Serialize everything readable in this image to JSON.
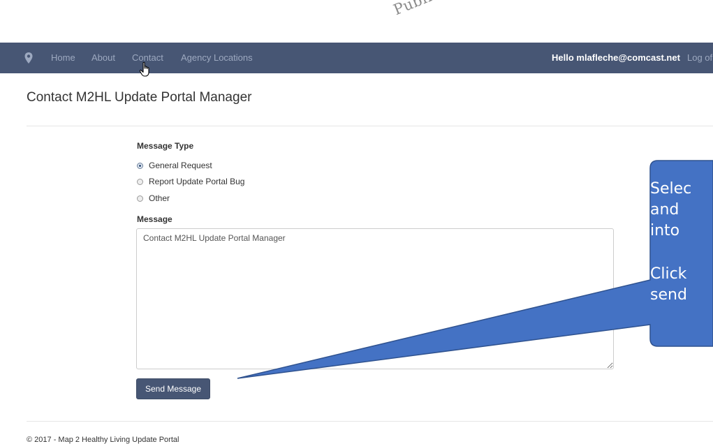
{
  "watermark": "Public",
  "nav": {
    "links": [
      "Home",
      "About",
      "Contact",
      "Agency Locations"
    ],
    "greeting": "Hello mlafleche@comcast.net",
    "logoff": "Log of"
  },
  "page": {
    "title": "Contact M2HL Update Portal Manager"
  },
  "form": {
    "message_type_label": "Message Type",
    "options": [
      "General Request",
      "Report Update Portal Bug",
      "Other"
    ],
    "selected_option": "General Request",
    "message_label": "Message",
    "message_value": "Contact M2HL Update Portal Manager",
    "send_label": "Send Message"
  },
  "callout": {
    "lines": [
      "Selec",
      "and",
      "into",
      "Click",
      "send"
    ],
    "color": "#4472c4"
  },
  "footer": "© 2017 - Map 2 Healthy Living Update Portal",
  "colors": {
    "navbar": "#475674",
    "nav_link": "#9da9c0",
    "button": "#475674"
  }
}
